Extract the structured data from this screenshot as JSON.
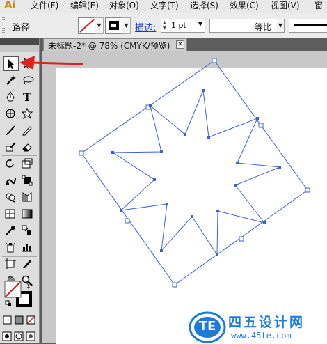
{
  "app": {
    "logo": "Ai"
  },
  "menu": {
    "items": [
      "文件(F)",
      "编辑(E)",
      "对象(O)",
      "文字(T)",
      "选择(S)",
      "效果(C)",
      "视图(V)",
      "窗"
    ]
  },
  "control_bar": {
    "selection_label": "路径",
    "stroke_link_label": "描边:",
    "stroke_weight": "1 pt",
    "profile_label": "等比"
  },
  "document": {
    "tab_title": "未标题-2* @ 78% (CMYK/预览)"
  },
  "watermark": {
    "logo_text": "TE",
    "site_name": "四五设计网",
    "url": "www.45te.com"
  },
  "colors": {
    "selection": "#3a62d8",
    "arrow": "#e0201c",
    "logo_blue": "#1c7ad8"
  },
  "tools": [
    "selection-tool",
    "direct-selection-tool",
    "magic-wand-tool",
    "lasso-tool",
    "pen-tool",
    "type-tool",
    "spiral-tool",
    "star-tool",
    "paintbrush-tool",
    "pencil-tool",
    "blob-brush-tool",
    "eraser-tool",
    "rotate-tool",
    "scale-tool",
    "warp-tool",
    "free-transform-tool",
    "shape-builder-tool",
    "perspective-grid-tool",
    "mesh-tool",
    "gradient-tool",
    "eyedropper-tool",
    "blend-tool",
    "symbol-sprayer-tool",
    "column-graph-tool",
    "artboard-tool",
    "slice-tool",
    "hand-tool",
    "zoom-tool"
  ]
}
